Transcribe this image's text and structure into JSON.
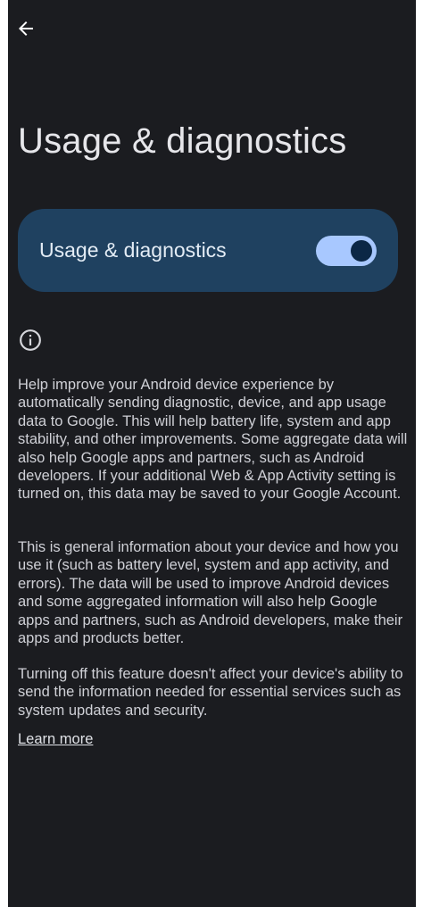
{
  "header": {
    "back_icon": "arrow-back-icon",
    "title": "Usage & diagnostics"
  },
  "toggle": {
    "label": "Usage & diagnostics",
    "state": "on",
    "track_color": "#a8c8ff",
    "thumb_color": "#0b2746",
    "card_color": "#1f4160"
  },
  "info": {
    "icon": "info-icon",
    "paragraphs": [
      "Help improve your Android device experience by automatically sending diagnostic, device, and app usage data to Google. This will help battery life, system and app stability, and other improvements. Some aggregate data will also help Google apps and partners, such as Android developers. If your additional Web & App Activity setting is turned on, this data may be saved to your Google Account.",
      "This is general information about your device and how you use it (such as battery level, system and app activity, and errors). The data will be used to improve Android devices and some aggregated information will also help Google apps and partners, such as Android developers, make their apps and products better.",
      "Turning off this feature doesn't affect your device's ability to send the information needed for essential services such as system updates and security."
    ],
    "learn_more": "Learn more"
  },
  "colors": {
    "background": "#1b1c20",
    "text": "#cfd0d6",
    "title": "#e6e6ea"
  }
}
